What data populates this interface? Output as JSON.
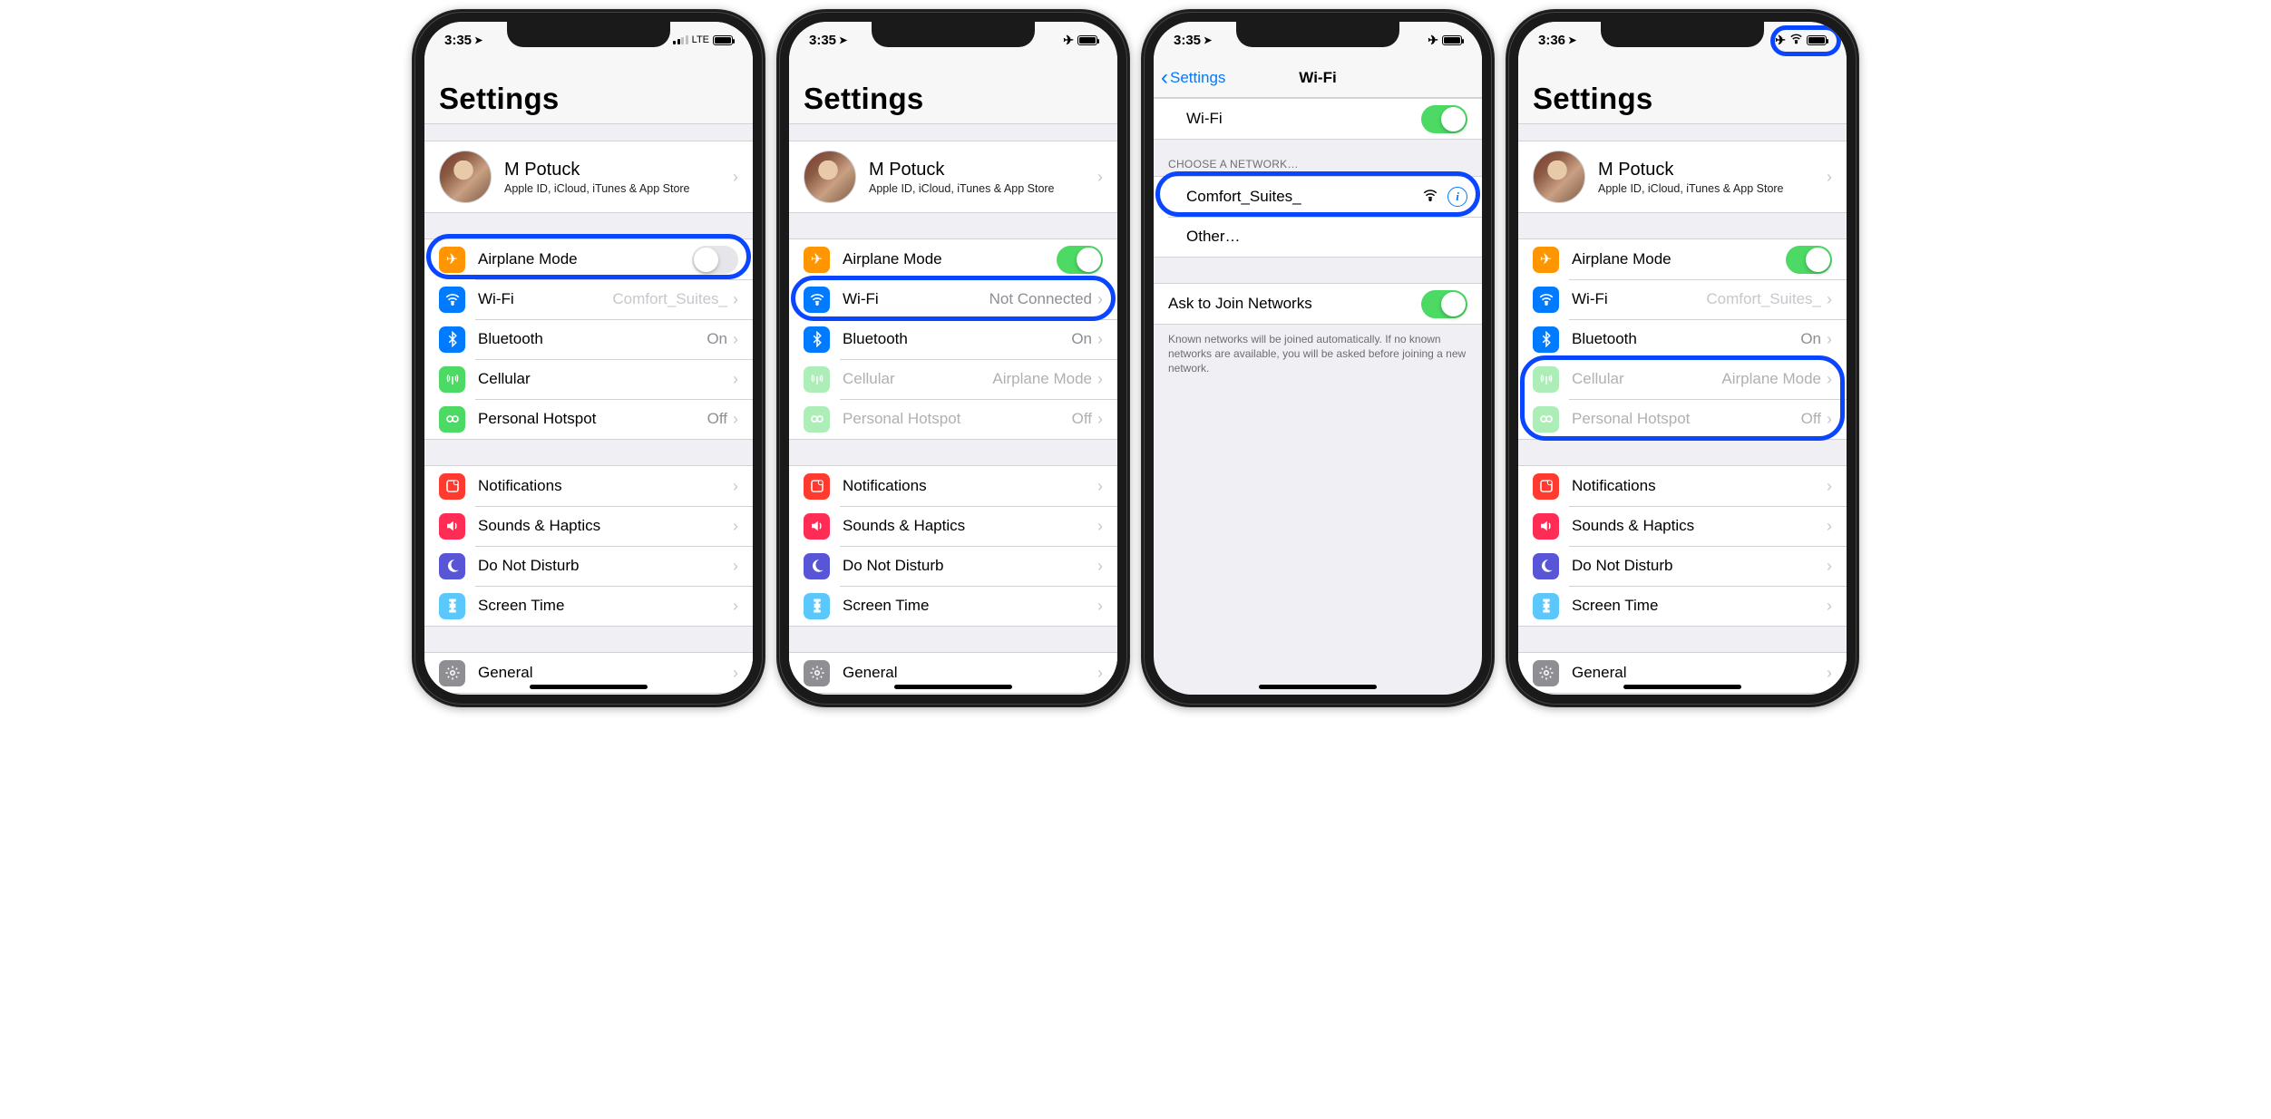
{
  "common": {
    "profile_name": "M Potuck",
    "profile_sub": "Apple ID, iCloud, iTunes & App Store",
    "labels": {
      "airplane": "Airplane Mode",
      "wifi": "Wi-Fi",
      "bluetooth": "Bluetooth",
      "cellular": "Cellular",
      "hotspot": "Personal Hotspot",
      "notifications": "Notifications",
      "sounds": "Sounds & Haptics",
      "dnd": "Do Not Disturb",
      "screentime": "Screen Time",
      "general": "General"
    },
    "values": {
      "bt_on": "On",
      "hotspot_off": "Off",
      "not_connected": "Not Connected",
      "airplane_mode": "Airplane Mode",
      "comfort": "Comfort_Suites_"
    },
    "settings_title": "Settings"
  },
  "screens": [
    {
      "time": "3:35",
      "status_right": [
        "sigbars",
        "lte",
        "battery"
      ],
      "lte_text": "LTE",
      "title": "Settings",
      "airplane_on": false,
      "wifi_detail": "Comfort_Suites_",
      "wifi_dim_detail": true,
      "cellular_detail": "",
      "cellular_dim": false,
      "hotspot_detail": "Off",
      "hotspot_dim": false,
      "highlight": "airplane-row"
    },
    {
      "time": "3:35",
      "status_right": [
        "airplane",
        "battery"
      ],
      "title": "Settings",
      "airplane_on": true,
      "wifi_detail": "Not Connected",
      "wifi_dim_detail": false,
      "cellular_detail": "Airplane Mode",
      "cellular_dim": true,
      "hotspot_detail": "Off",
      "hotspot_dim": true,
      "highlight": "wifi-row"
    },
    {
      "time": "3:35",
      "status_right": [
        "airplane",
        "battery"
      ],
      "nav_back": "Settings",
      "nav_title": "Wi-Fi",
      "wifi_toggle_label": "Wi-Fi",
      "wifi_toggle_on": true,
      "choose_header": "CHOOSE A NETWORK…",
      "network_name": "Comfort_Suites_",
      "other_label": "Other…",
      "join_label": "Ask to Join Networks",
      "join_on": true,
      "join_footer": "Known networks will be joined automatically. If no known networks are available, you will be asked before joining a new network.",
      "highlight": "network-row"
    },
    {
      "time": "3:36",
      "status_right": [
        "airplane",
        "wifi",
        "battery"
      ],
      "title": "Settings",
      "airplane_on": true,
      "wifi_detail": "Comfort_Suites_",
      "wifi_dim_detail": true,
      "cellular_detail": "Airplane Mode",
      "cellular_dim": true,
      "hotspot_detail": "Off",
      "hotspot_dim": true,
      "highlight": "cell-hotspot",
      "highlight2": "status-right"
    }
  ]
}
